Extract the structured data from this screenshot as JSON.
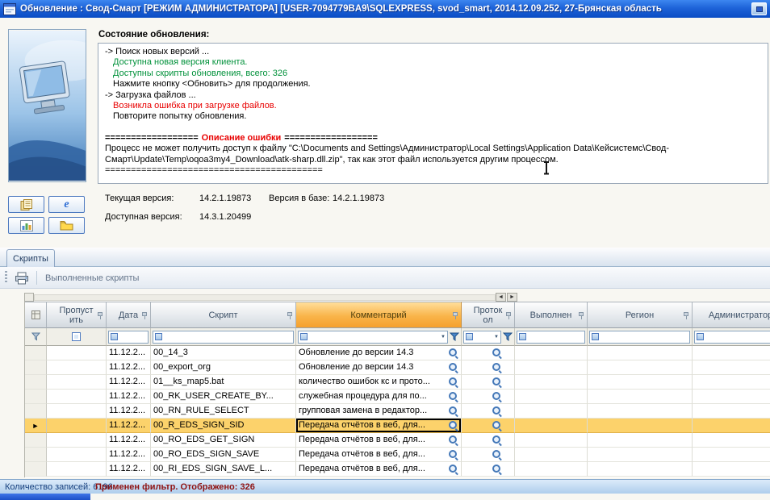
{
  "colors": {
    "titlebar_blue": "#1E63D8",
    "header_highlight_orange": "#F5A02C",
    "selected_row_amber": "#FCD26B",
    "log_green": "#00913A",
    "log_red": "#E80000",
    "status_records_navy": "#17407E",
    "status_filter_darkred": "#8F1212"
  },
  "titlebar": {
    "title": "Обновление : Свод-Смарт [РЕЖИМ АДМИНИСТРАТОРА] [USER-7094779BA9\\SQLEXPRESS, svod_smart, 2014.12.09.252, 27-Брянская область",
    "app_icon": "form-icon",
    "button_icon": "window-button-icon"
  },
  "update_status": {
    "heading": "Состояние обновления:",
    "lines": [
      "-> Поиск новых версий ...",
      "Доступна новая версия клиента.",
      "Доступны скрипты обновления, всего: 326",
      "Нажмите кнопку <Обновить> для продолжения.",
      "-> Загрузка файлов ...",
      "Возникла ошибка при загрузке файлов.",
      "Повторите попытку обновления."
    ],
    "error_header": {
      "eq_left": "==================",
      "label": "Описание ошибки",
      "eq_right": "=================="
    },
    "error_text": "Процесс не может получить доступ к файлу \"C:\\Documents and Settings\\Администратор\\Local Settings\\Application Data\\Кейсистемс\\Свод-Смарт\\Update\\Temp\\oqoa3my4_Download\\atk-sharp.dll.zip\", так как этот файл используется другим процессом.",
    "error_footer": "=========================================="
  },
  "versions": {
    "current_label": "Текущая версия:",
    "current_value": "14.2.1.19873",
    "db_label": "Версия в базе:",
    "db_value": "14.2.1.19873",
    "available_label": "Доступная версия:",
    "available_value": "14.3.1.20499"
  },
  "side_buttons": [
    {
      "icon": "journal-icon"
    },
    {
      "icon": "browser-icon"
    },
    {
      "icon": "chart-icon"
    },
    {
      "icon": "folder-icon"
    }
  ],
  "tabs": {
    "active_label": "Скрипты"
  },
  "toolbar": {
    "print_icon": "printer-icon",
    "executed_scripts_label": "Выполненные скрипты"
  },
  "grid": {
    "selected_marker": "►",
    "headers": {
      "skip": "Пропустить",
      "date": "Дата",
      "script": "Скрипт",
      "comment": "Комментарий",
      "protocol": "Протокол",
      "executed": "Выполнен",
      "region": "Регион",
      "admin": "Администратор"
    },
    "rows": [
      {
        "date": "11.12.2...",
        "script": "00_14_3",
        "comment": "Обновление до версии 14.3"
      },
      {
        "date": "11.12.2...",
        "script": "00_export_org",
        "comment": "Обновление до версии 14.3"
      },
      {
        "date": "11.12.2...",
        "script": "01__ks_map5.bat",
        "comment": "количество ошибок кс и прото..."
      },
      {
        "date": "11.12.2...",
        "script": "00_RK_USER_CREATE_BY...",
        "comment": "служебная процедура для по..."
      },
      {
        "date": "11.12.2...",
        "script": "00_RN_RULE_SELECT",
        "comment": "групповая замена в редактор..."
      },
      {
        "date": "11.12.2...",
        "script": "00_R_EDS_SIGN_SID",
        "comment": "Передача отчётов в веб, для...",
        "selected": true
      },
      {
        "date": "11.12.2...",
        "script": "00_RO_EDS_GET_SIGN",
        "comment": "Передача отчётов в веб, для..."
      },
      {
        "date": "11.12.2...",
        "script": "00_RO_EDS_SIGN_SAVE",
        "comment": "Передача отчётов в веб, для..."
      },
      {
        "date": "11.12.2...",
        "script": "00_RI_EDS_SIGN_SAVE_L...",
        "comment": "Передача отчётов в веб, для..."
      }
    ]
  },
  "statusbar": {
    "records_label": "Количество записей: 6196",
    "filter_label": "Применен фильтр. Отображено: 326"
  }
}
